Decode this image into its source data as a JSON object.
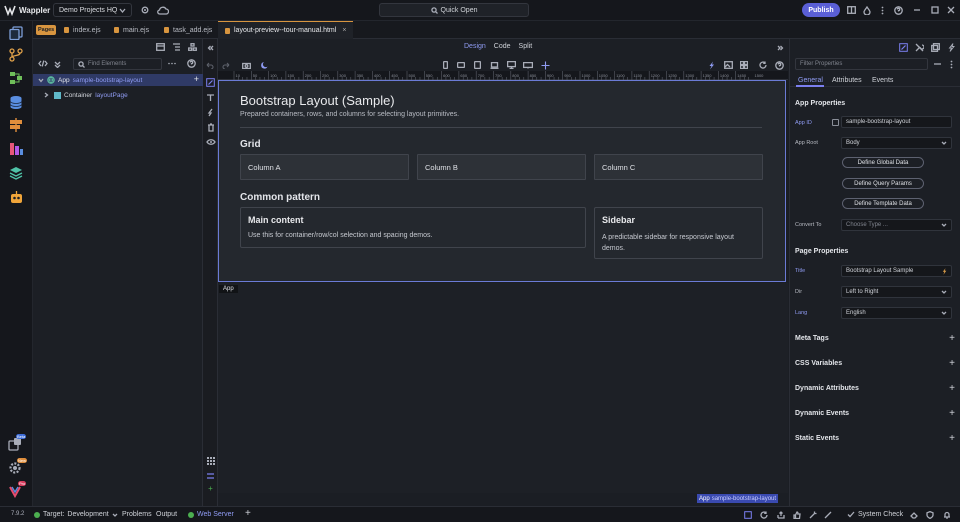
{
  "titlebar": {
    "brand": "Wappler",
    "project": "Demo Projects HQ",
    "quick_open": "Quick Open",
    "publish": "Publish"
  },
  "tabs": {
    "pages_badge": "Pages",
    "items": [
      "index.ejs",
      "main.ejs",
      "task_add.ejs",
      "layout-preview--tour-manual.html"
    ]
  },
  "left": {
    "find_placeholder": "Find Elements",
    "tree": [
      {
        "type": "App",
        "name": "sample-bootstrap-layout"
      },
      {
        "type": "Container",
        "name": "layoutPage"
      }
    ]
  },
  "design": {
    "modes": [
      "Design",
      "Code",
      "Split"
    ]
  },
  "ruler": {
    "ticks": [
      "10",
      "50",
      "100",
      "150",
      "200",
      "250",
      "300",
      "350",
      "400",
      "450",
      "500",
      "550",
      "600",
      "650",
      "700",
      "750",
      "800",
      "850",
      "900",
      "950",
      "1000",
      "1050",
      "1100",
      "1150",
      "1200",
      "1250",
      "1300",
      "1350",
      "1400",
      "1450",
      "1500"
    ]
  },
  "page": {
    "title": "Bootstrap Layout (Sample)",
    "subtitle": "Prepared containers, rows, and columns for selecting layout primitives.",
    "grid_heading": "Grid",
    "columns": [
      "Column A",
      "Column B",
      "Column C"
    ],
    "pattern_heading": "Common pattern",
    "main_title": "Main content",
    "main_text": "Use this for container/row/col selection and spacing demos.",
    "side_title": "Sidebar",
    "side_text": "A predictable sidebar for responsive layout demos."
  },
  "selection": {
    "label": "App",
    "breadcrumb_type": "App",
    "breadcrumb_name": "sample-bootstrap-layout"
  },
  "right": {
    "filter_placeholder": "Filter Properties",
    "tabs": [
      "General",
      "Attributes",
      "Events"
    ],
    "app_props": "App Properties",
    "app_id_label": "App ID",
    "app_id": "sample-bootstrap-layout",
    "app_root_label": "App Root",
    "app_root": "Body",
    "buttons": [
      "Define Global Data",
      "Define Query Params",
      "Define Template Data"
    ],
    "convert_label": "Convert To",
    "convert_placeholder": "Choose Type ...",
    "page_props": "Page Properties",
    "title_label": "Title",
    "title_value": "Bootstrap Layout Sample",
    "dir_label": "Dir",
    "dir_value": "Left to Right",
    "lang_label": "Lang",
    "lang_value": "English",
    "sections": [
      "Meta Tags",
      "CSS Variables",
      "Dynamic Attributes",
      "Dynamic Events",
      "Static Events"
    ]
  },
  "status": {
    "version": "7.9.2",
    "target_label": "Target:",
    "target": "Development",
    "problems": "Problems",
    "output": "Output",
    "web_server": "Web Server",
    "system_check": "System Check"
  },
  "badges": {
    "beta": "Beta",
    "new": "New",
    "pro": "Pro"
  },
  "colors": {
    "accent": "#7b7ff0",
    "canvas": "#24282e",
    "success": "#4caf50",
    "warning": "#d8953f"
  }
}
